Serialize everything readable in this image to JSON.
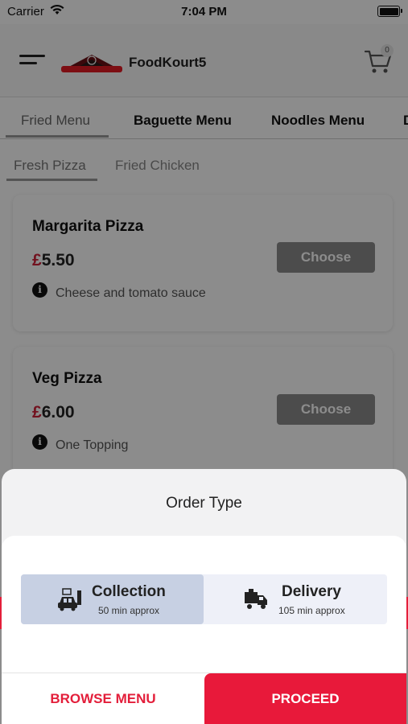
{
  "status_bar": {
    "carrier": "Carrier",
    "time": "7:04 PM"
  },
  "header": {
    "app_name": "FoodKourt5",
    "cart_count": "0"
  },
  "tabs": [
    {
      "label": "Fried Menu"
    },
    {
      "label": "Baguette Menu"
    },
    {
      "label": "Noodles Menu"
    },
    {
      "label": "D"
    }
  ],
  "subtabs": [
    {
      "label": "Fresh Pizza"
    },
    {
      "label": "Fried Chicken"
    }
  ],
  "items": [
    {
      "name": "Margarita Pizza",
      "currency": "£",
      "price": "5.50",
      "button": "Choose",
      "description": "Cheese and tomato sauce"
    },
    {
      "name": "Veg Pizza",
      "currency": "£",
      "price": "6.00",
      "button": "Choose",
      "description": "One Topping"
    }
  ],
  "order_sheet": {
    "title": "Order Type",
    "options": [
      {
        "title": "Collection",
        "subtitle": "50 min approx",
        "icon": "car-collection-icon",
        "selected": true
      },
      {
        "title": "Delivery",
        "subtitle": "105 min approx",
        "icon": "delivery-truck-icon",
        "selected": false
      }
    ],
    "browse_label": "BROWSE MENU",
    "proceed_label": "PROCEED"
  },
  "colors": {
    "accent": "#e8193a",
    "selected_option": "#c7d0e3",
    "price_currency": "#d0213a"
  }
}
